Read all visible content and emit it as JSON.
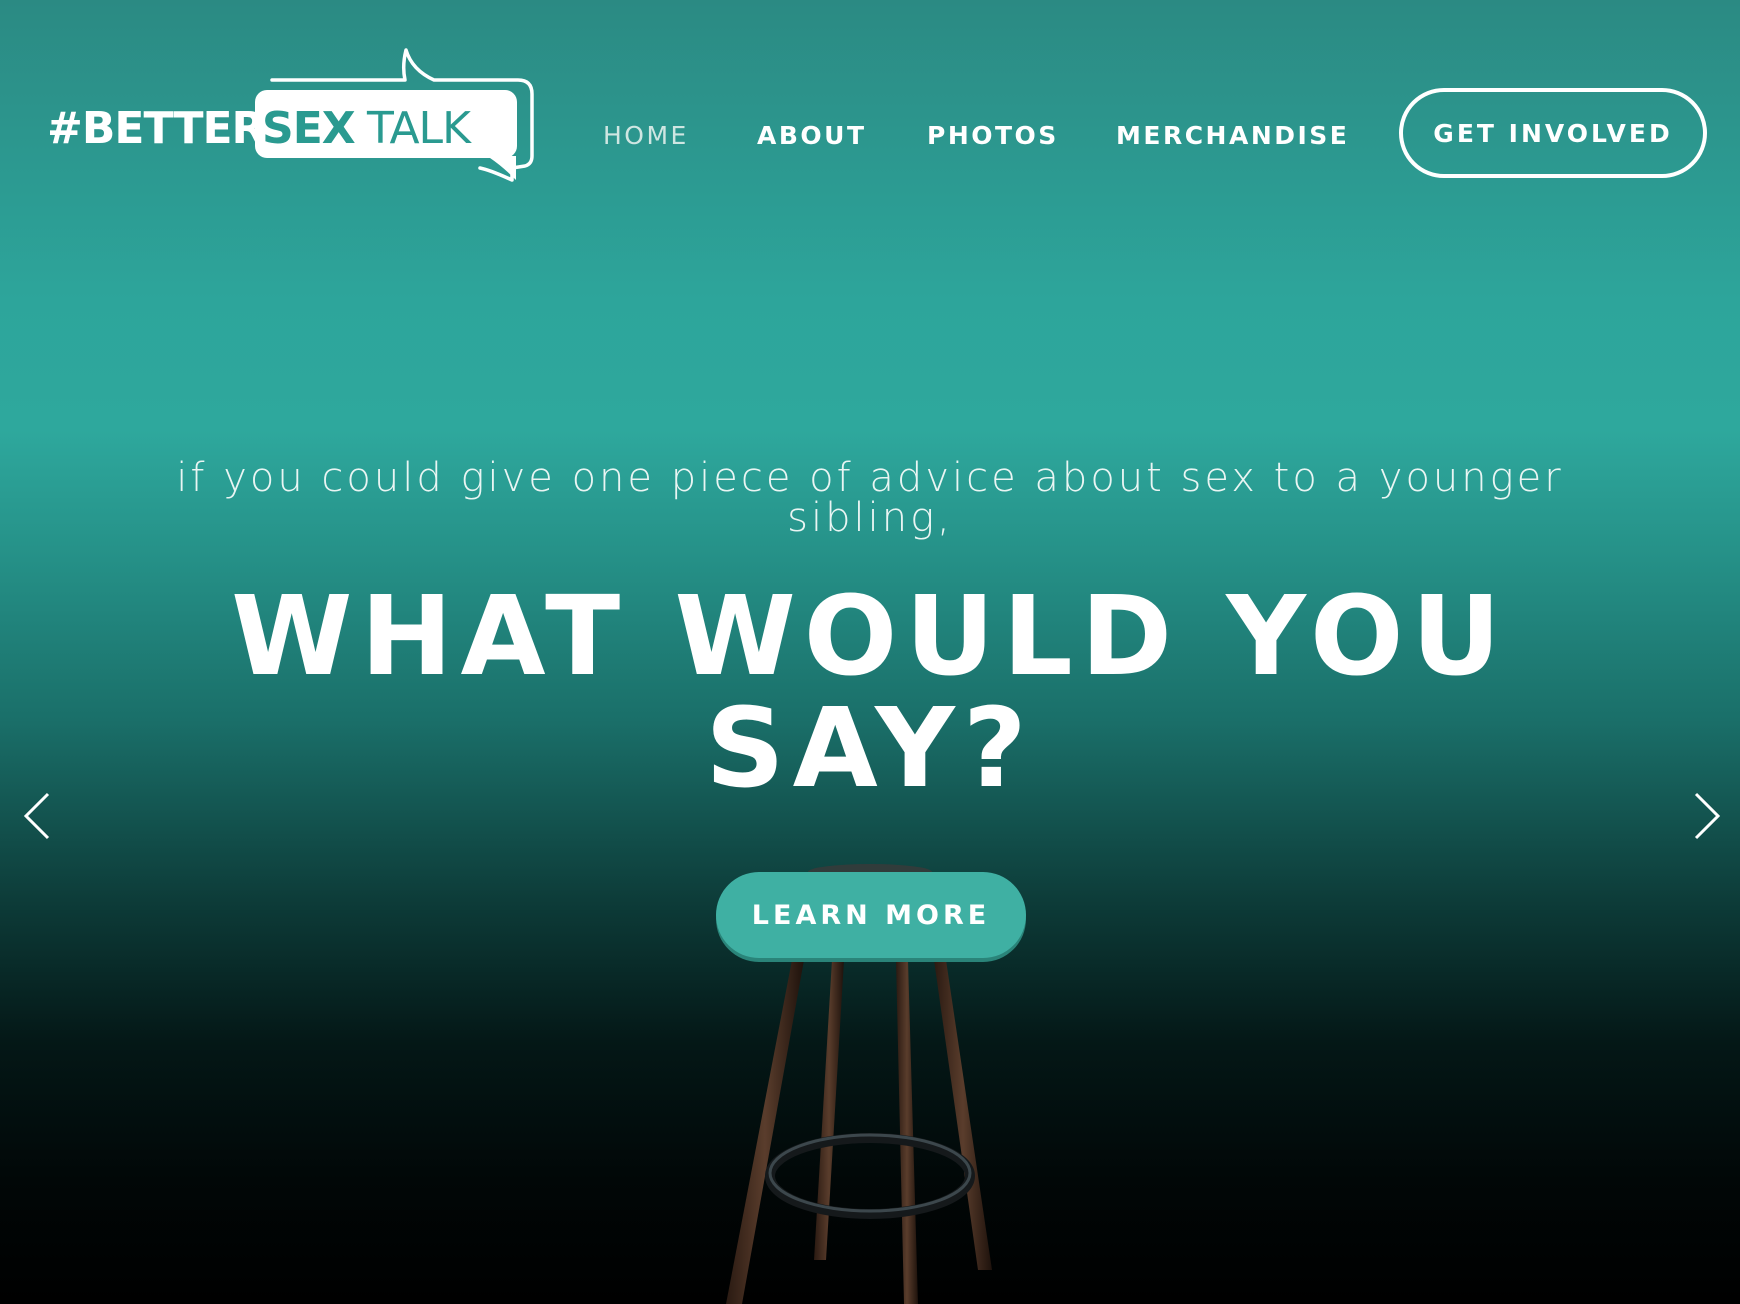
{
  "header": {
    "logo": {
      "hash_text": "#BETTER",
      "box_text_bold": "SEX",
      "box_text_light": "TALK"
    },
    "nav": [
      {
        "label": "HOME",
        "active": true
      },
      {
        "label": "ABOUT",
        "active": false
      },
      {
        "label": "PHOTOS",
        "active": false
      },
      {
        "label": "MERCHANDISE",
        "active": false
      }
    ],
    "cta_label": "GET INVOLVED"
  },
  "hero": {
    "subtitle_line1": "if you could give one piece of advice about sex to a younger",
    "subtitle_line2": "sibling,",
    "headline_line1": "WHAT WOULD YOU",
    "headline_line2": "SAY?",
    "button_label": "LEARN MORE",
    "prev_icon": "chevron-left-icon",
    "next_icon": "chevron-right-icon"
  },
  "colors": {
    "teal_top": "#2b8a83",
    "teal_mid": "#2ea89d",
    "button_teal": "#3fb0a3",
    "bottom": "#000000",
    "text": "#ffffff"
  }
}
